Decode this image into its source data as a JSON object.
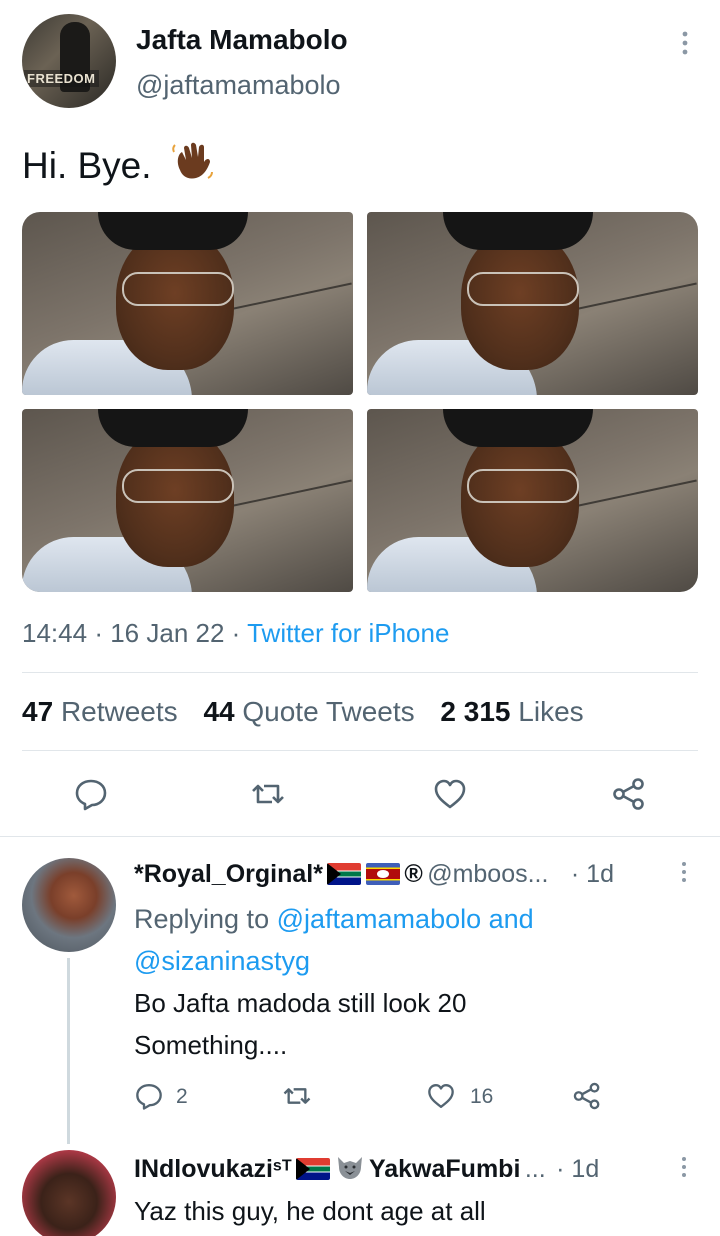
{
  "tweet": {
    "author": {
      "display_name": "Jafta Mamabolo",
      "handle": "@jaftamamabolo",
      "avatar_label": "FREEDOM"
    },
    "text": "Hi. Bye.",
    "emoji": "waving-hand-dark-skin",
    "photos_count": 4,
    "time": "14:44",
    "date": "16 Jan 22",
    "source": "Twitter for iPhone",
    "sep": "·",
    "stats": {
      "retweets_count": "47",
      "retweets_label": "Retweets",
      "quotes_count": "44",
      "quotes_label": "Quote Tweets",
      "likes_count": "2 315",
      "likes_label": "Likes"
    }
  },
  "replies": [
    {
      "display_name": "*Royal_Orginal*",
      "suffix": "®",
      "handle": "@mboos...",
      "time": "· 1d",
      "replying_prefix": "Replying to",
      "replying_to_1": "@jaftamamabolo",
      "replying_and": "and",
      "replying_to_2": "@sizaninastyg",
      "text_line1": "Bo Jafta madoda still look 20",
      "text_line2": "Something....",
      "reply_count": "2",
      "like_count": "16"
    },
    {
      "display_name_a": "INdlovukazi",
      "display_name_sup": "sT",
      "display_name_b": "YakwaFumbi",
      "ellipsis": "...",
      "time": "· 1d",
      "text": "Yaz this guy, he dont age at all"
    }
  ],
  "colors": {
    "accent": "#1d9bf0",
    "muted": "#536471",
    "text": "#0f1419",
    "divider": "#e1e6ea"
  }
}
